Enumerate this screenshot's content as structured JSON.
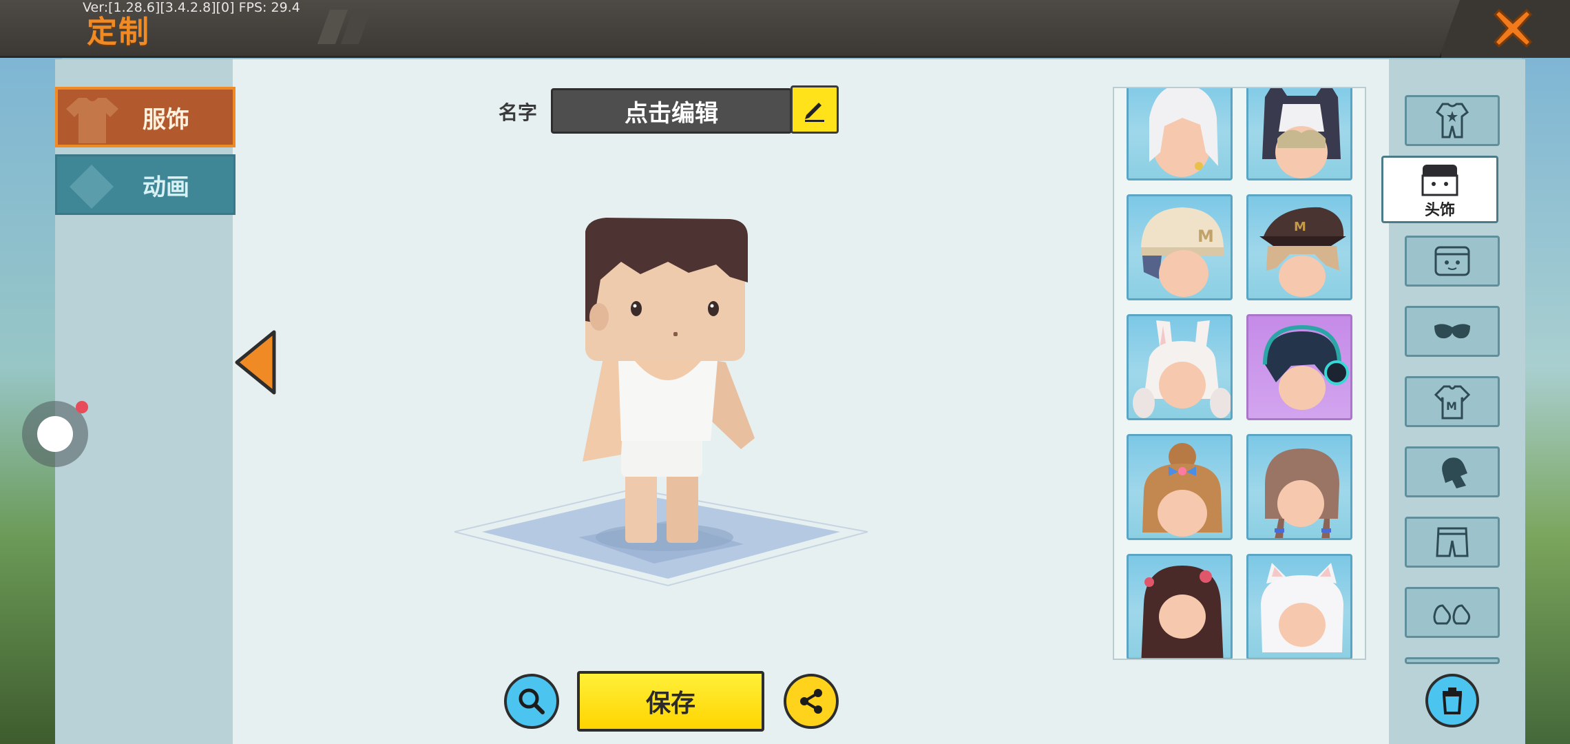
{
  "topbar": {
    "title": "定制",
    "version_text": "Ver:[1.28.6][3.4.2.8][0] FPS: 29.4"
  },
  "left_tabs": [
    {
      "label": "服饰",
      "active": true
    },
    {
      "label": "动画",
      "active": false
    }
  ],
  "name_row": {
    "label": "名字",
    "value": "点击编辑"
  },
  "actions": {
    "save_label": "保存"
  },
  "items": [
    {
      "id": "white-hair-earring",
      "bg": "blue"
    },
    {
      "id": "husky-hood",
      "bg": "blue"
    },
    {
      "id": "beige-beanie",
      "bg": "blue"
    },
    {
      "id": "brown-cap",
      "bg": "blue"
    },
    {
      "id": "bunny-twintails",
      "bg": "blue"
    },
    {
      "id": "headphones-dark-hair",
      "bg": "purple"
    },
    {
      "id": "bun-with-bow",
      "bg": "blue"
    },
    {
      "id": "braid-brown",
      "bg": "blue"
    },
    {
      "id": "long-dark-hair-roses",
      "bg": "blue"
    },
    {
      "id": "white-cat-ears",
      "bg": "blue"
    }
  ],
  "categories": [
    {
      "icon": "suit-icon",
      "label": ""
    },
    {
      "icon": "head-icon",
      "label": "头饰",
      "active": true
    },
    {
      "icon": "face-icon",
      "label": ""
    },
    {
      "icon": "mask-icon",
      "label": ""
    },
    {
      "icon": "shirt-icon",
      "label": ""
    },
    {
      "icon": "glove-icon",
      "label": ""
    },
    {
      "icon": "pants-icon",
      "label": ""
    },
    {
      "icon": "shoes-icon",
      "label": ""
    }
  ],
  "colors": {
    "accent_orange": "#f08a24",
    "save_yellow": "#ffe21a",
    "tab_active": "#b25a2e",
    "tab_inactive": "#3f8797"
  }
}
